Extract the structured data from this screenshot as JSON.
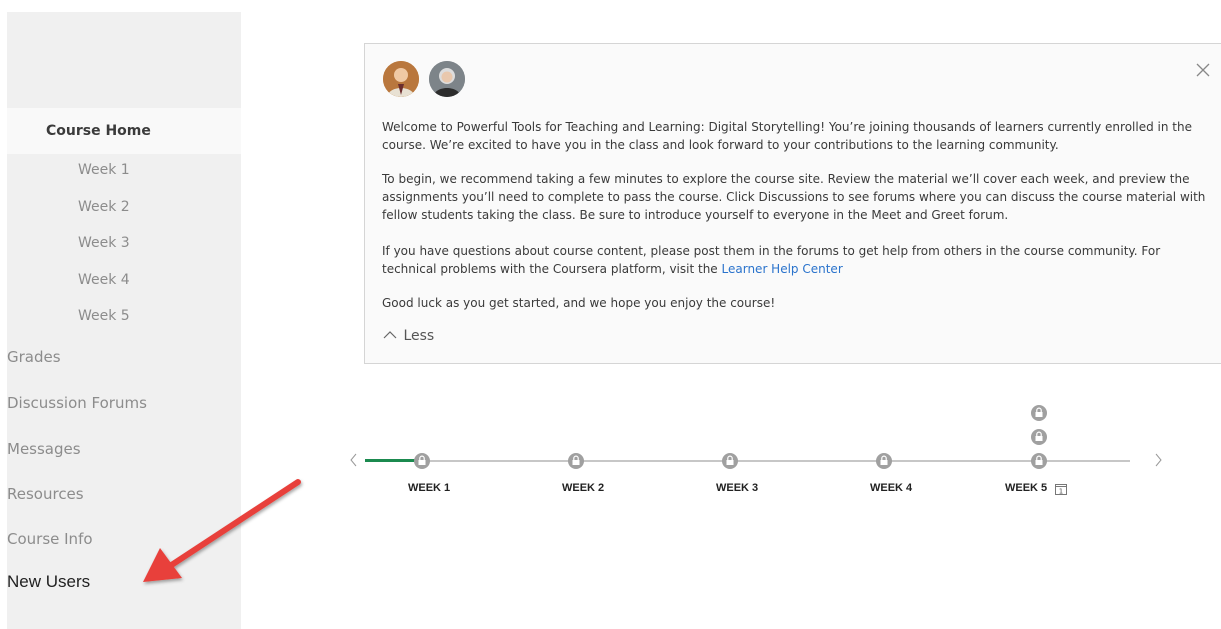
{
  "sidebar": {
    "course_home": "Course Home",
    "weeks": [
      "Week 1",
      "Week 2",
      "Week 3",
      "Week 4",
      "Week 5"
    ],
    "items": [
      "Grades",
      "Discussion Forums",
      "Messages",
      "Resources",
      "Course Info"
    ],
    "new_users": "New Users"
  },
  "welcome": {
    "p1": "Welcome to Powerful Tools for Teaching and Learning: Digital Storytelling! You’re joining thousands of learners currently enrolled in the course. We’re excited to have you in the class and look forward to your contributions to the learning community.",
    "p2": "To begin, we recommend taking a few minutes to explore the course site. Review the material we’ll cover each week, and preview the assignments you’ll need to complete to pass the course. Click Discussions to see forums where you can discuss the course material with fellow students taking the class. Be sure to introduce yourself to everyone in the Meet and Greet forum.",
    "p3": "If you have questions about course content, please post them in the forums to get help from others in the course community. For technical problems with the Coursera platform, visit the",
    "p3_link": "Learner Help Center",
    "p4": "Good luck as you get started, and we hope you enjoy the course!",
    "less": "Less"
  },
  "timeline": {
    "weeks": [
      "WEEK 1",
      "WEEK 2",
      "WEEK 3",
      "WEEK 4",
      "WEEK 5"
    ],
    "week5_badge": "1"
  },
  "colors": {
    "progress": "#1b8a4f",
    "link": "#2a73cc",
    "arrow": "#e8403a"
  }
}
